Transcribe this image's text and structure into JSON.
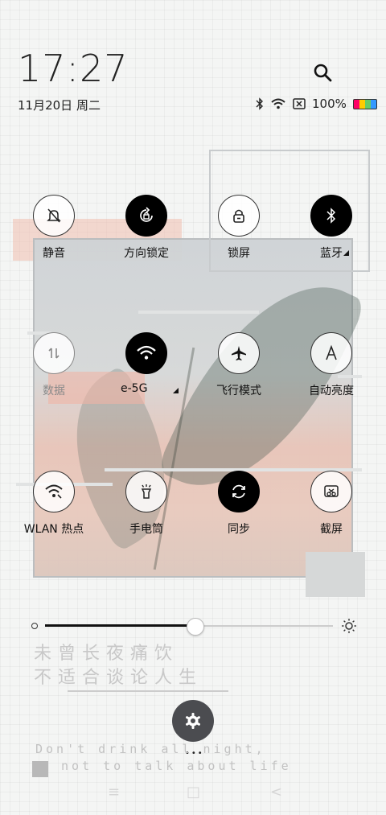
{
  "status": {
    "time": "17:27",
    "date": "11月20日 周二",
    "battery": "100%"
  },
  "tiles": [
    {
      "label": "静音",
      "icon": "bell-off-icon",
      "active": false
    },
    {
      "label": "方向锁定",
      "icon": "rotation-lock-icon",
      "active": true
    },
    {
      "label": "锁屏",
      "icon": "lock-icon",
      "active": false
    },
    {
      "label": "蓝牙",
      "icon": "bluetooth-icon",
      "active": true
    },
    {
      "label": "数据",
      "icon": "mobile-data-icon",
      "active": false
    },
    {
      "label": "e-5G",
      "icon": "wifi-icon",
      "active": true
    },
    {
      "label": "飞行模式",
      "icon": "airplane-icon",
      "active": false
    },
    {
      "label": "自动亮度",
      "icon": "auto-brightness-icon",
      "active": false
    },
    {
      "label": "WLAN 热点",
      "icon": "hotspot-icon",
      "active": false
    },
    {
      "label": "手电筒",
      "icon": "flashlight-icon",
      "active": false
    },
    {
      "label": "同步",
      "icon": "sync-icon",
      "active": true
    },
    {
      "label": "截屏",
      "icon": "screenshot-icon",
      "active": false
    }
  ],
  "brightness": {
    "level": 0.52
  },
  "wallpaper": {
    "poem_line1": "未曾长夜痛饮",
    "poem_line2": "不适合谈论人生",
    "eng_line1": "Don't drink all night,",
    "eng_line2": "not to talk about life"
  },
  "nav": {
    "menu": "≡",
    "home": "□",
    "back": "<"
  }
}
